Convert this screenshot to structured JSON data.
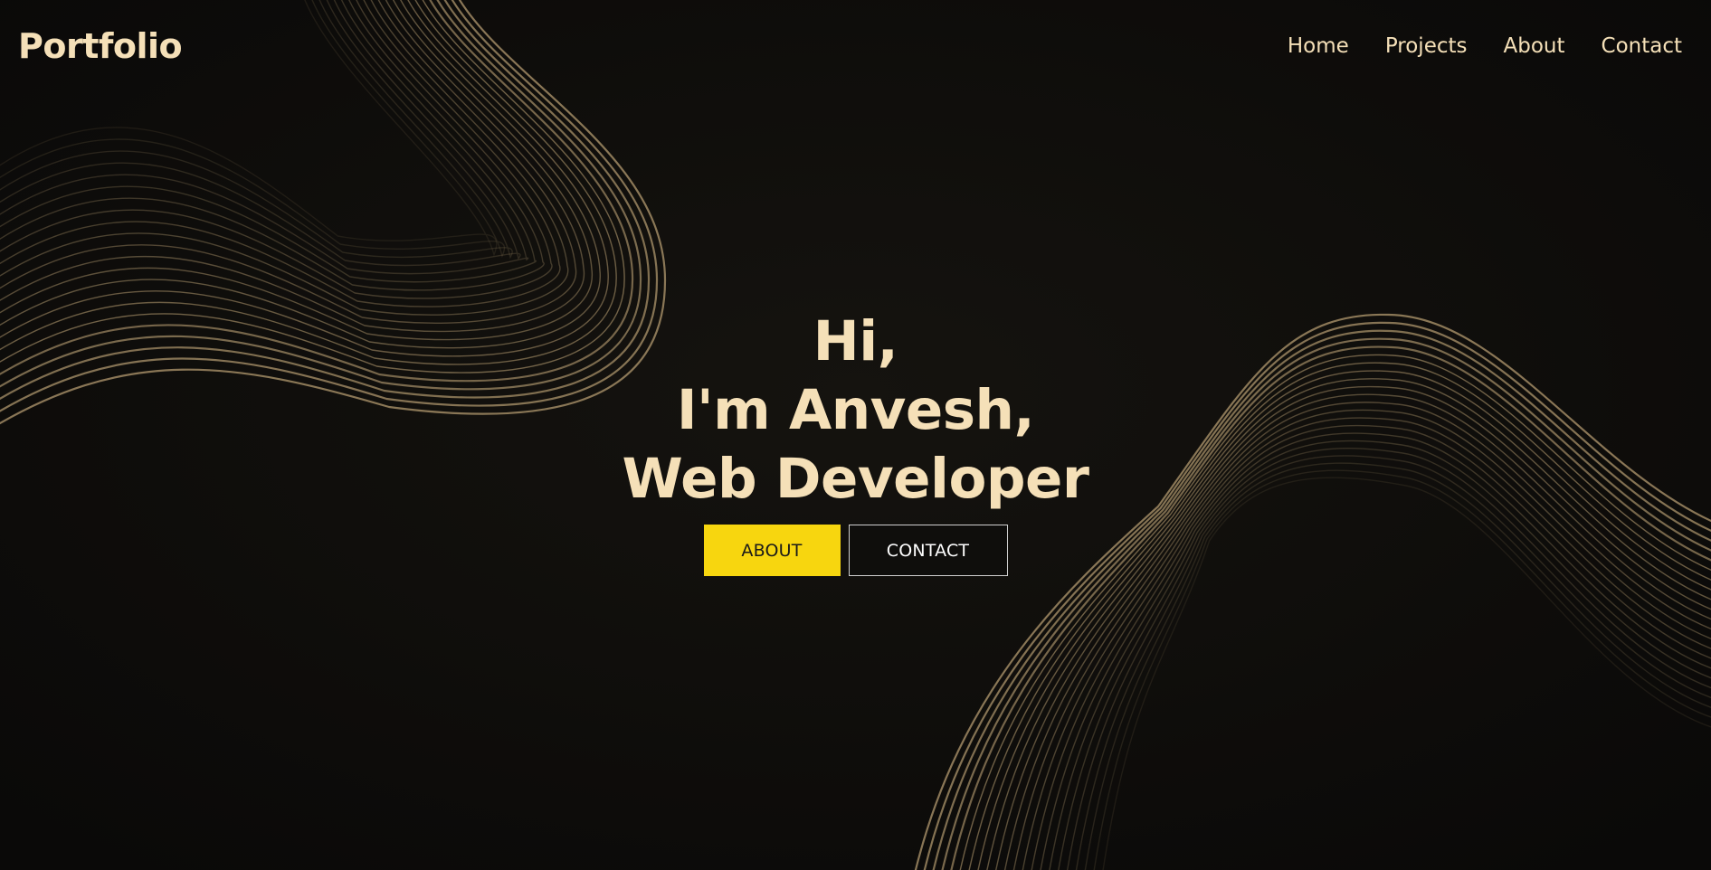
{
  "header": {
    "logo": "Portfolio",
    "nav": [
      {
        "label": "Home"
      },
      {
        "label": "Projects"
      },
      {
        "label": "About"
      },
      {
        "label": "Contact"
      }
    ]
  },
  "hero": {
    "line1": "Hi,",
    "line2": "I'm Anvesh,",
    "line3": "Web Developer",
    "about_button": "ABOUT",
    "contact_button": "CONTACT"
  },
  "colors": {
    "background": "#0c0b09",
    "text_accent": "#f5e0b8",
    "button_yellow": "#f7d60f",
    "button_dark_text": "#1a1a1a",
    "button_light_text": "#ffffff",
    "wave_gold": "#a08a64"
  }
}
